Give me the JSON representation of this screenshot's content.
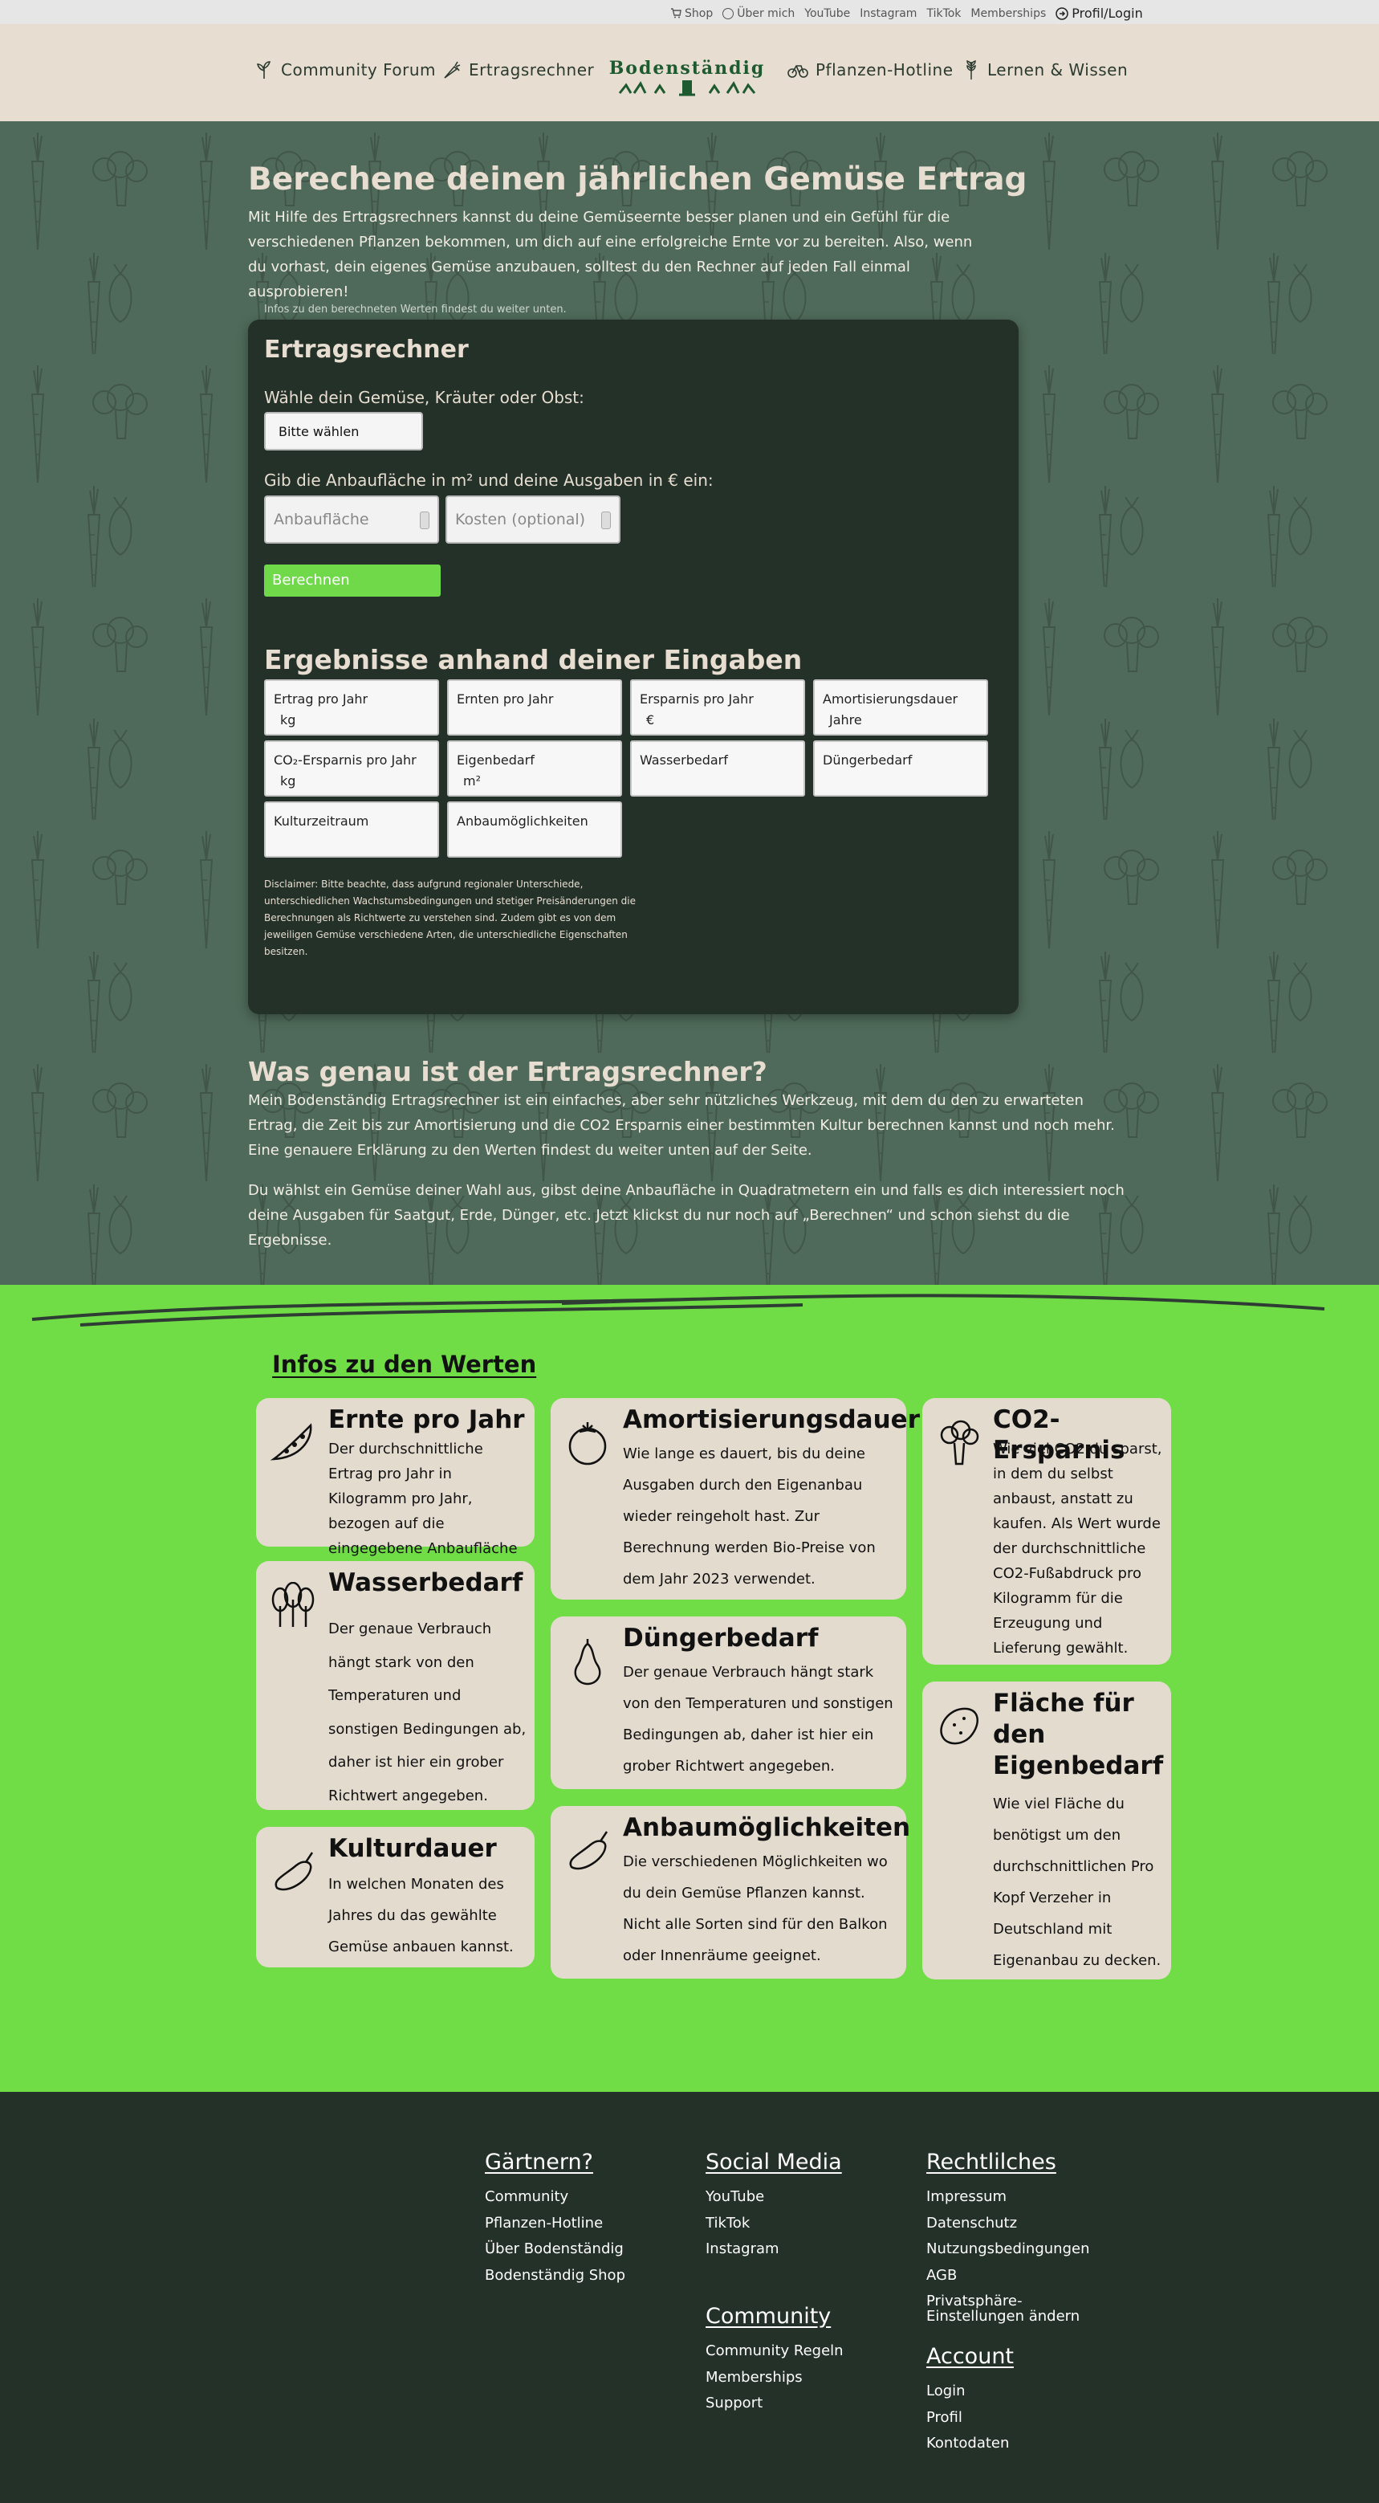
{
  "topbar": {
    "shop": "Shop",
    "ueber_mich": "Über mich",
    "youtube": "YouTube",
    "instagram": "Instagram",
    "tiktok": "TikTok",
    "memberships": "Memberships",
    "profil": "Profil/Login"
  },
  "nav": {
    "community_forum": "Community Forum",
    "ertragsrechner": "Ertragsrechner",
    "logo_text": "Bodenständig",
    "pflanzen_hotline": "Pflanzen-Hotline",
    "lernen_wissen": "Lernen & Wissen"
  },
  "hero": {
    "title": "Berechene deinen jährlichen Gemüse Ertrag",
    "text": "Mit Hilfe des Ertragsrechners kannst du deine Gemüseernte besser planen und ein Gefühl für die verschiedenen Pflanzen bekommen, um dich auf eine erfolgreiche Ernte vor zu bereiten. Also, wenn du vorhast, dein eigenes Gemüse anzubauen, solltest du den Rechner auf jeden Fall einmal ausprobieren!",
    "hint": "Infos zu den berechneten Werten findest du weiter unten."
  },
  "calculator": {
    "title": "Ertragsrechner",
    "select_label": "Wähle dein Gemüse, Kräuter oder Obst:",
    "select_value": "Bitte wählen",
    "area_label": "Gib die Anbaufläche in m² und deine Ausgaben in € ein:",
    "area_placeholder": "Anbaufläche",
    "cost_placeholder": "Kosten (optional)",
    "button": "Berechnen",
    "results_title": "Ergebnisse anhand deiner Eingaben",
    "results": [
      {
        "label": "Ertrag pro Jahr",
        "unit": "kg"
      },
      {
        "label": "Ernten pro Jahr",
        "unit": ""
      },
      {
        "label": "Ersparnis pro Jahr",
        "unit": "€"
      },
      {
        "label": "Amortisierungsdauer",
        "unit": "Jahre"
      },
      {
        "label": "CO₂-Ersparnis pro Jahr",
        "unit": "kg"
      },
      {
        "label": "Eigenbedarf",
        "unit": "m²"
      },
      {
        "label": "Wasserbedarf",
        "unit": ""
      },
      {
        "label": "Düngerbedarf",
        "unit": ""
      },
      {
        "label": "Kulturzeitraum",
        "unit": ""
      },
      {
        "label": "Anbaumöglichkeiten",
        "unit": ""
      }
    ],
    "disclaimer": "Disclaimer: Bitte beachte, dass aufgrund regionaler Unterschiede, unterschiedlichen Wachstumsbedingungen und stetiger Preisänderungen die Berechnungen als Richtwerte zu verstehen sind. Zudem gibt es von dem jeweiligen Gemüse verschiedene Arten, die unterschiedliche Eigenschaften besitzen."
  },
  "what": {
    "title": "Was genau ist der Ertragsrechner?",
    "p1": "Mein Bodenständig Ertragsrechner ist ein einfaches, aber sehr nützliches Werkzeug, mit dem du den zu erwarteten Ertrag, die Zeit bis zur Amortisierung und die CO2 Ersparnis einer bestimmten Kultur berechnen kannst und noch mehr. Eine genauere Erklärung zu den Werten findest du weiter unten auf der Seite.",
    "p2": "Du wählst ein Gemüse deiner Wahl aus, gibst deine Anbaufläche in Quadratmetern ein und falls es dich interessiert noch deine Ausgaben für Saatgut, Erde, Dünger, etc. Jetzt klickst du nur noch auf „Berechnen“ und schon siehst du die Ergebnisse."
  },
  "infos": {
    "title": "Infos zu den Werten",
    "cards": {
      "ernte": {
        "title": "Ernte pro Jahr",
        "text": "Der durchschnittliche Ertrag pro Jahr in Kilogramm pro Jahr, bezogen auf die eingegebene Anbaufläche",
        "icon": "pea-pod-icon"
      },
      "wasser": {
        "title": "Wasserbedarf",
        "text": "Der genaue Verbrauch hängt stark von den Temperaturen und sonstigen Bedingungen ab, daher ist hier ein grober Richtwert angegeben.",
        "icon": "spinach-icon"
      },
      "kultur": {
        "title": "Kulturdauer",
        "text": "In welchen Monaten des Jahres du das gewählte Gemüse anbauen kannst.",
        "icon": "eggplant-icon"
      },
      "amort": {
        "title": "Amortisierungsdauer",
        "text": "Wie lange es dauert, bis du deine Ausgaben durch den Eigenanbau wieder reingeholt hast. Zur Berechnung werden Bio-Preise von dem Jahr 2023 verwendet.",
        "icon": "tomato-icon"
      },
      "duenger": {
        "title": "Düngerbedarf",
        "text": "Der genaue Verbrauch hängt stark von den Temperaturen und sonstigen Bedingungen ab, daher ist hier ein grober Richtwert angegeben.",
        "icon": "squash-icon"
      },
      "anbau": {
        "title": "Anbaumöglichkeiten",
        "text": "Die verschiedenen Möglichkeiten wo du dein Gemüse Pflanzen kannst. Nicht alle Sorten sind für den Balkon oder Innenräume geeignet.",
        "icon": "eggplant-icon"
      },
      "co2": {
        "title": "CO2-Ersparnis",
        "text": "Wie viel CO2 du sparst, in dem du selbst anbaust, anstatt zu kaufen. Als Wert wurde der durchschnittliche CO2-Fußabdruck pro Kilogramm für die Erzeugung und Lieferung gewählt.",
        "icon": "broccoli-icon"
      },
      "flaeche": {
        "title": "Fläche für den Eigenbedarf",
        "text": "Wie viel Fläche du benötigst um den durchschnittlichen Pro Kopf Verzeher in Deutschland mit Eigenanbau zu decken.",
        "icon": "potato-icon"
      }
    }
  },
  "footer": {
    "gaertnern": {
      "title": "Gärtnern?",
      "links": [
        "Community",
        "Pflanzen-Hotline",
        "Über Bodenständig",
        "Bodenständig Shop"
      ]
    },
    "social": {
      "title": "Social Media",
      "links": [
        "YouTube",
        "TikTok",
        "Instagram"
      ]
    },
    "rechtliches": {
      "title": "Rechtlilches",
      "links": [
        "Impressum",
        "Datenschutz",
        "Nutzungsbedingungen",
        "AGB",
        "Privatsphäre-Einstellungen ändern"
      ]
    },
    "community": {
      "title": "Community",
      "links": [
        "Community Regeln",
        "Memberships",
        "Support"
      ]
    },
    "account": {
      "title": "Account",
      "links": [
        "Login",
        "Profil",
        "Kontodaten"
      ]
    }
  },
  "colors": {
    "accent_green": "#70dd46",
    "dark_green": "#243128",
    "hero_green": "#4f6a5a",
    "beige": "#e7ddd1"
  }
}
